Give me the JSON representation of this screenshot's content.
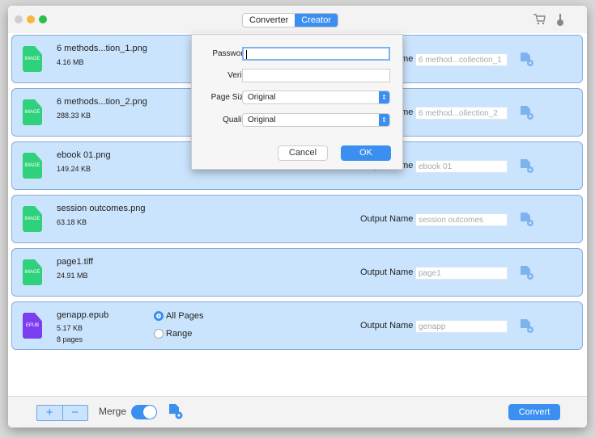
{
  "titlebar": {
    "tabs": [
      {
        "label": "Converter",
        "active": false
      },
      {
        "label": "Creator",
        "active": true
      }
    ],
    "icons": [
      "cart-icon",
      "brush-icon"
    ]
  },
  "files": [
    {
      "name": "6 methods...tion_1.png",
      "size": "4.16 MB",
      "type_label": "IMAGE",
      "output_label": "Output Name",
      "output_name": "6 method...collection_1"
    },
    {
      "name": "6 methods...tion_2.png",
      "size": "288.33 KB",
      "type_label": "IMAGE",
      "output_label": "Output Name",
      "output_name": "6 method...ollection_2"
    },
    {
      "name": "ebook 01.png",
      "size": "149.24 KB",
      "type_label": "IMAGE",
      "output_label": "Output Name",
      "output_name": "ebook 01"
    },
    {
      "name": "session outcomes.png",
      "size": "63.18 KB",
      "type_label": "IMAGE",
      "output_label": "Output Name",
      "output_name": "session outcomes"
    },
    {
      "name": "page1.tiff",
      "size": "24.91 MB",
      "type_label": "IMAGE",
      "output_label": "Output Name",
      "output_name": "page1"
    },
    {
      "name": "genapp.epub",
      "size": "5.17 KB",
      "pages": "8 pages",
      "type_label": "EPUB",
      "output_label": "Output Name",
      "output_name": "genapp",
      "page_options": {
        "all": "All Pages",
        "range": "Range",
        "selected": "all"
      }
    }
  ],
  "dialog": {
    "password_label": "Password:",
    "password_value": "",
    "verify_label": "Verify:",
    "verify_value": "",
    "page_size_label": "Page Size:",
    "page_size_value": "Original",
    "quality_label": "Quality:",
    "quality_value": "Original",
    "cancel_label": "Cancel",
    "ok_label": "OK"
  },
  "footer": {
    "add_label": "+",
    "remove_label": "−",
    "merge_label": "Merge",
    "merge_on": true,
    "convert_label": "Convert"
  },
  "colors": {
    "accent": "#3b8ff0",
    "row_bg": "#cbe4fd",
    "image_icon": "#2fd17c",
    "epub_icon": "#7a3df0"
  }
}
